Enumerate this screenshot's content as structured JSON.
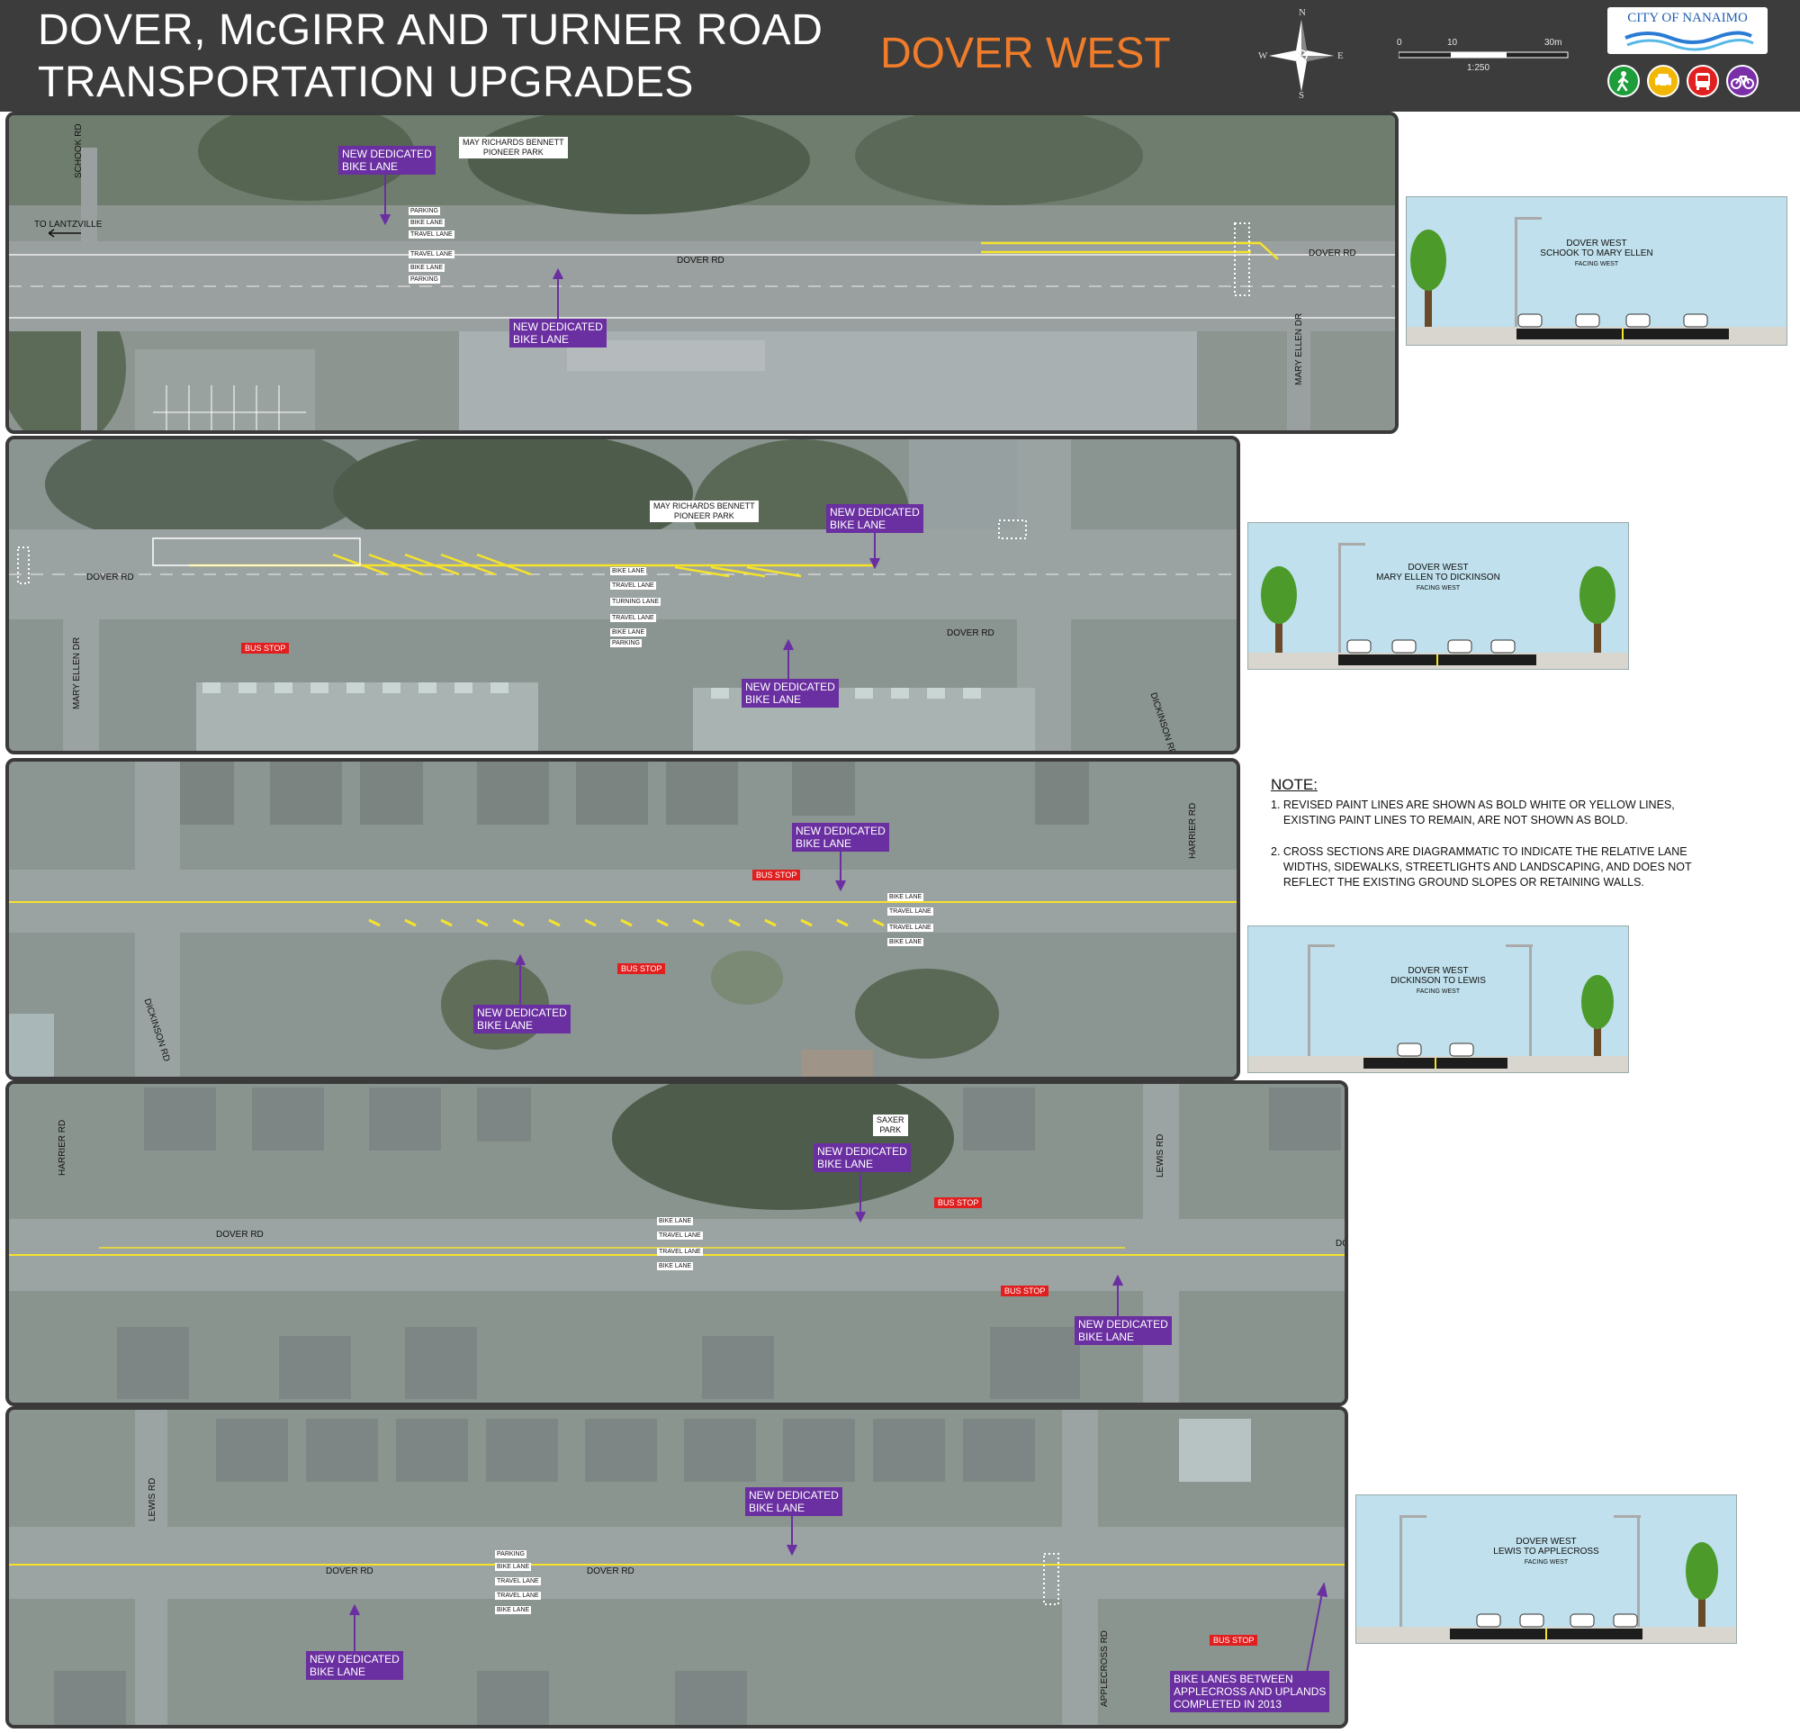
{
  "header": {
    "title_line1": "DOVER, McGIRR AND TURNER ROAD",
    "title_line2": "TRANSPORTATION UPGRADES",
    "subtitle": "DOVER WEST",
    "compass": {
      "n": "N",
      "s": "S",
      "e": "E",
      "w": "W"
    },
    "scale": {
      "t0": "0",
      "t1": "10",
      "t2": "30m",
      "ratio": "1:250"
    },
    "logo_text": "CITY OF NANAIMO",
    "mode_icons": [
      {
        "name": "pedestrian-icon",
        "color": "#1e9e3a"
      },
      {
        "name": "car-icon",
        "color": "#f2b705"
      },
      {
        "name": "bus-icon",
        "color": "#e11f1f"
      },
      {
        "name": "bicycle-icon",
        "color": "#7a2fa8"
      }
    ]
  },
  "colors": {
    "header_bg": "#3c3c3c",
    "subtitle": "#f07c2a",
    "callout": "#6a2fa0",
    "bus_stop": "#e11f1f",
    "yellow_paint": "#f5e32a"
  },
  "panels": [
    {
      "roads": [
        "SCHOOK RD",
        "TO LANTZVILLE",
        "DOVER RD",
        "DOVER RD",
        "MARY ELLEN DR"
      ],
      "park": "MAY RICHARDS BENNETT\nPIONEER PARK",
      "lanes": [
        "PARKING",
        "BIKE LANE",
        "TRAVEL LANE",
        "TRAVEL LANE",
        "BIKE LANE",
        "PARKING"
      ],
      "callouts": [
        "NEW DEDICATED\nBIKE LANE",
        "NEW DEDICATED\nBIKE LANE"
      ]
    },
    {
      "roads": [
        "DOVER RD",
        "DOVER RD",
        "MARY ELLEN DR",
        "DICKINSON RD"
      ],
      "park": "MAY RICHARDS BENNETT\nPIONEER PARK",
      "lanes": [
        "BIKE LANE",
        "TRAVEL LANE",
        "TURNING LANE",
        "TRAVEL LANE",
        "BIKE LANE",
        "PARKING"
      ],
      "callouts": [
        "NEW DEDICATED\nBIKE LANE",
        "NEW DEDICATED\nBIKE LANE"
      ],
      "bus_stops": [
        "BUS STOP"
      ]
    },
    {
      "roads": [
        "HARRIER RD",
        "DICKINSON RD"
      ],
      "lanes": [
        "BIKE LANE",
        "TRAVEL LANE",
        "TRAVEL LANE",
        "BIKE LANE"
      ],
      "callouts": [
        "NEW DEDICATED\nBIKE LANE",
        "NEW DEDICATED\nBIKE LANE"
      ],
      "bus_stops": [
        "BUS STOP",
        "BUS STOP"
      ]
    },
    {
      "roads": [
        "HARRIER RD",
        "DOVER RD",
        "LEWIS RD",
        "DO"
      ],
      "park": "SAXER\nPARK",
      "lanes": [
        "BIKE LANE",
        "TRAVEL LANE",
        "TRAVEL LANE",
        "BIKE LANE"
      ],
      "callouts": [
        "NEW DEDICATED\nBIKE LANE",
        "NEW DEDICATED\nBIKE LANE"
      ],
      "bus_stops": [
        "BUS STOP",
        "BUS STOP"
      ]
    },
    {
      "roads": [
        "LEWIS RD",
        "DOVER RD",
        "DOVER RD",
        "APPLECROSS RD"
      ],
      "lanes": [
        "PARKING",
        "BIKE LANE",
        "TRAVEL LANE",
        "TRAVEL LANE",
        "BIKE LANE"
      ],
      "callouts": [
        "NEW DEDICATED\nBIKE LANE",
        "NEW DEDICATED\nBIKE LANE",
        "BIKE LANES BETWEEN\nAPPLECROSS AND UPLANDS\nCOMPLETED IN 2013"
      ],
      "bus_stops": [
        "BUS STOP"
      ]
    }
  ],
  "cross_sections": [
    {
      "title": "DOVER WEST",
      "segment": "SCHOOK TO MARY ELLEN",
      "facing": "FACING WEST"
    },
    {
      "title": "DOVER WEST",
      "segment": "MARY ELLEN TO DICKINSON",
      "facing": "FACING WEST"
    },
    {
      "title": "DOVER WEST",
      "segment": "DICKINSON TO LEWIS",
      "facing": "FACING WEST"
    },
    {
      "title": "DOVER WEST",
      "segment": "LEWIS TO APPLECROSS",
      "facing": "FACING WEST"
    }
  ],
  "notes": {
    "heading": "NOTE:",
    "items": [
      "1. REVISED PAINT LINES ARE SHOWN AS BOLD WHITE OR YELLOW LINES,\n    EXISTING PAINT LINES TO REMAIN, ARE NOT SHOWN AS BOLD.",
      "2. CROSS SECTIONS ARE DIAGRAMMATIC TO INDICATE THE RELATIVE LANE\n    WIDTHS, SIDEWALKS, STREETLIGHTS AND LANDSCAPING, AND DOES NOT\n    REFLECT THE EXISTING GROUND SLOPES OR RETAINING WALLS."
    ]
  }
}
